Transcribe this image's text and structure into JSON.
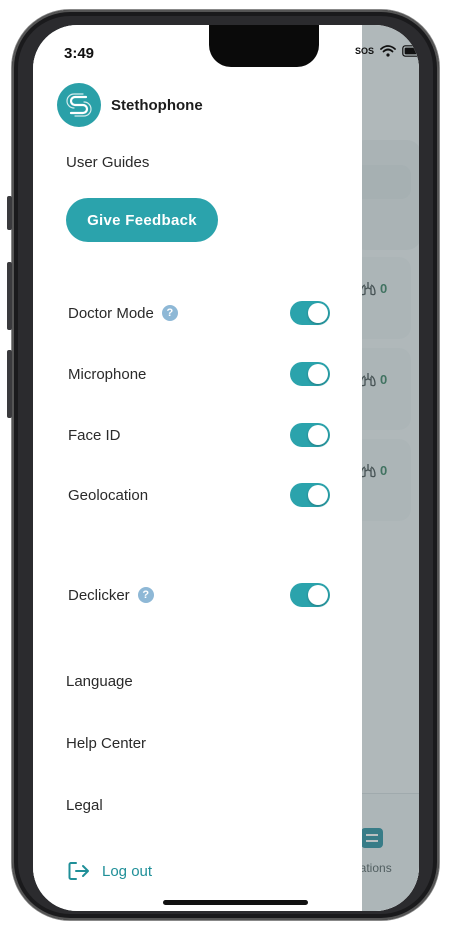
{
  "status_bar": {
    "time": "3:49",
    "sos": "SOS"
  },
  "brand": {
    "name": "Stethophone"
  },
  "drawer": {
    "user_guides": "User Guides",
    "feedback_button": "Give Feedback",
    "settings": [
      {
        "label": "Doctor Mode",
        "has_help": true,
        "enabled": true
      },
      {
        "label": "Microphone",
        "has_help": false,
        "enabled": true
      },
      {
        "label": "Face ID",
        "has_help": false,
        "enabled": true
      },
      {
        "label": "Geolocation",
        "has_help": false,
        "enabled": true
      },
      {
        "label": "Declicker",
        "has_help": true,
        "enabled": true
      }
    ],
    "help_glyph": "?",
    "links": {
      "language": "Language",
      "help_center": "Help Center",
      "legal": "Legal"
    },
    "logout": "Log out"
  },
  "background": {
    "metrics": [
      "0",
      "0",
      "0"
    ],
    "tab_label": "nations"
  },
  "colors": {
    "accent": "#2ba3ac",
    "help": "#8eb8d6",
    "text": "#2a2a2a"
  },
  "icons": {
    "logo": "stethophone-logo-icon",
    "help": "question-mark-icon",
    "logout": "logout-arrow-icon",
    "lungs": "lungs-icon",
    "tab": "list-icon"
  }
}
